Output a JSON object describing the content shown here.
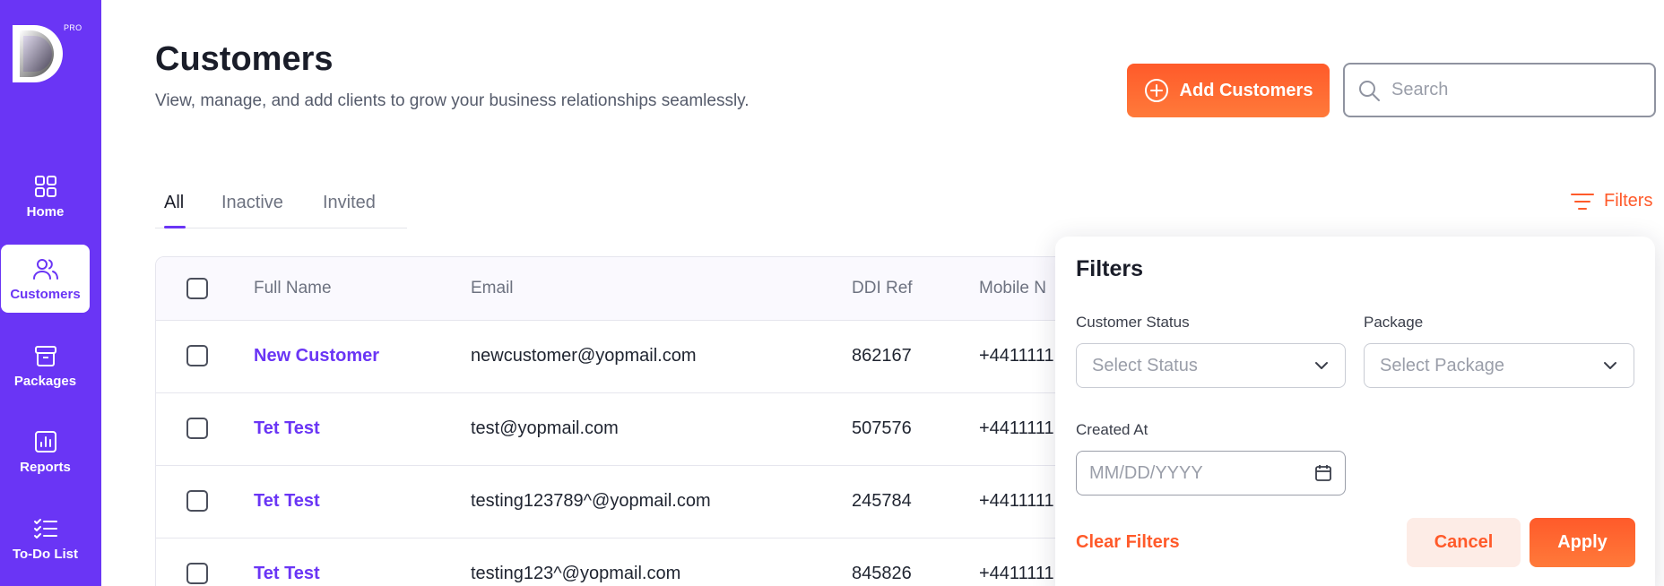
{
  "brand": {
    "badge": "PRO",
    "accent": "#6a35f5",
    "orange": "#ff5a2a"
  },
  "sidebar": {
    "items": [
      {
        "label": "Home",
        "icon": "grid-icon"
      },
      {
        "label": "Customers",
        "icon": "users-icon",
        "active": true
      },
      {
        "label": "Packages",
        "icon": "archive-icon"
      },
      {
        "label": "Reports",
        "icon": "bar-chart-icon"
      },
      {
        "label": "To-Do List",
        "icon": "checklist-icon"
      }
    ]
  },
  "header": {
    "title": "Customers",
    "subtitle": "View, manage, and add clients to grow your business relationships seamlessly.",
    "add_label": "Add Customers",
    "search_placeholder": "Search"
  },
  "tabs": [
    {
      "label": "All",
      "active": true
    },
    {
      "label": "Inactive"
    },
    {
      "label": "Invited"
    }
  ],
  "filters_label": "Filters",
  "table": {
    "columns": [
      "Full Name",
      "Email",
      "DDI Ref",
      "Mobile N"
    ],
    "rows": [
      {
        "name": "New Customer",
        "email": "newcustomer@yopmail.com",
        "ddi": "862167",
        "mobile": "+4411111"
      },
      {
        "name": "Tet Test",
        "email": "test@yopmail.com",
        "ddi": "507576",
        "mobile": "+4411111"
      },
      {
        "name": "Tet Test",
        "email": "testing123789^@yopmail.com",
        "ddi": "245784",
        "mobile": "+4411111"
      },
      {
        "name": "Tet Test",
        "email": "testing123^@yopmail.com",
        "ddi": "845826",
        "mobile": "+4411111"
      }
    ]
  },
  "filter_panel": {
    "title": "Filters",
    "status_label": "Customer Status",
    "status_placeholder": "Select Status",
    "package_label": "Package",
    "package_placeholder": "Select Package",
    "created_label": "Created At",
    "date_placeholder": "MM/DD/YYYY",
    "clear_label": "Clear Filters",
    "cancel_label": "Cancel",
    "apply_label": "Apply"
  }
}
